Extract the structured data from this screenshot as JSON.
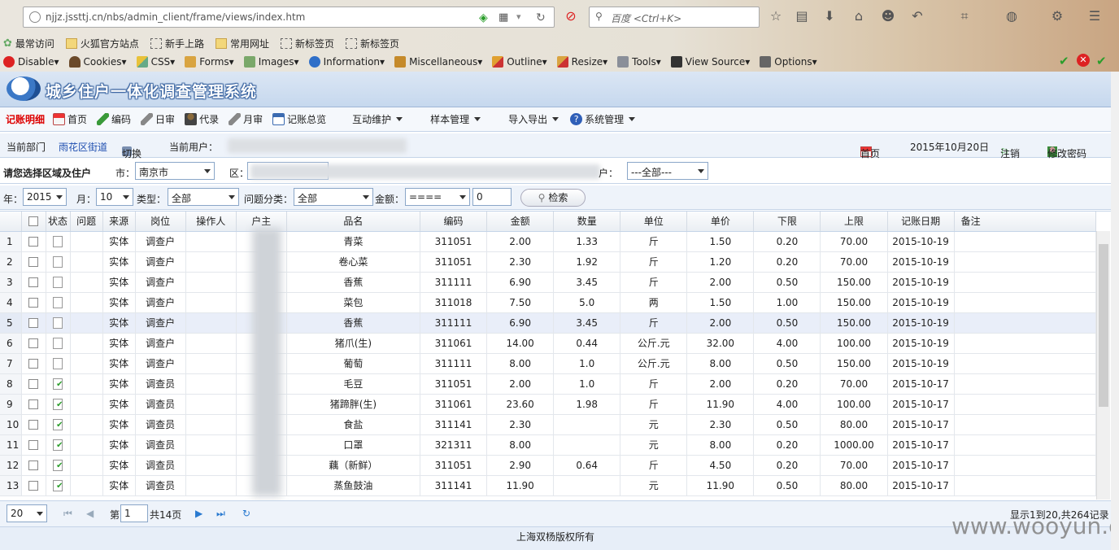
{
  "browser": {
    "url": "njjz.jssttj.cn/nbs/admin_client/frame/views/index.htm",
    "search_placeholder": "百度 <Ctrl+K>",
    "bookmarks": [
      "最常访问",
      "火狐官方站点",
      "新手上路",
      "常用网址",
      "新标签页",
      "新标签页"
    ],
    "webdev": [
      "Disable▾",
      "Cookies▾",
      "CSS▾",
      "Forms▾",
      "Images▾",
      "Information▾",
      "Miscellaneous▾",
      "Outline▾",
      "Resize▾",
      "Tools▾",
      "View Source▾",
      "Options▾"
    ]
  },
  "app": {
    "title": "城乡住户一体化调查管理系统",
    "menu": {
      "current": "记账明细",
      "items": [
        "首页",
        "编码",
        "日审",
        "代录",
        "月审",
        "记账总览"
      ],
      "dropdowns": [
        "互动维护",
        "样本管理",
        "导入导出",
        "系统管理"
      ]
    },
    "userbar": {
      "dept_label": "当前部门",
      "dept_value": "雨花区街道",
      "switch": "切换",
      "user_label": "当前用户：",
      "home": "首页",
      "date": "2015年10月20日",
      "logout": "注销",
      "change_pwd": "修改密码"
    },
    "filter1": {
      "prompt": "请您选择区域及住户",
      "city_label": "市：",
      "city_value": "南京市",
      "district_label": "区：",
      "household_label": "户：",
      "household_value": "---全部---"
    },
    "filter2": {
      "year_label": "年：",
      "year_value": "2015",
      "month_label": "月：",
      "month_value": "10",
      "type_label": "类型：",
      "type_value": "全部",
      "issue_label": "问题分类：",
      "issue_value": "全部",
      "amount_label": "金额：",
      "amount_op": "====",
      "amount_value": "0",
      "search": "检索"
    },
    "grid": {
      "columns": [
        "",
        "状态",
        "问题",
        "来源",
        "岗位",
        "操作人",
        "户主",
        "品名",
        "编码",
        "金额",
        "数量",
        "单位",
        "单价",
        "下限",
        "上限",
        "记账日期",
        "备注"
      ],
      "rows": [
        {
          "n": "1",
          "ok": false,
          "src": "实体",
          "post": "调查户",
          "name": "青菜",
          "code": "311051",
          "amt": "2.00",
          "qty": "1.33",
          "unit": "斤",
          "price": "1.50",
          "lo": "0.20",
          "hi": "70.00",
          "date": "2015-10-19"
        },
        {
          "n": "2",
          "ok": false,
          "src": "实体",
          "post": "调查户",
          "name": "卷心菜",
          "code": "311051",
          "amt": "2.30",
          "qty": "1.92",
          "unit": "斤",
          "price": "1.20",
          "lo": "0.20",
          "hi": "70.00",
          "date": "2015-10-19"
        },
        {
          "n": "3",
          "ok": false,
          "src": "实体",
          "post": "调查户",
          "name": "香蕉",
          "code": "311111",
          "amt": "6.90",
          "qty": "3.45",
          "unit": "斤",
          "price": "2.00",
          "lo": "0.50",
          "hi": "150.00",
          "date": "2015-10-19"
        },
        {
          "n": "4",
          "ok": false,
          "src": "实体",
          "post": "调查户",
          "name": "菜包",
          "code": "311018",
          "amt": "7.50",
          "qty": "5.0",
          "unit": "两",
          "price": "1.50",
          "lo": "1.00",
          "hi": "150.00",
          "date": "2015-10-19"
        },
        {
          "n": "5",
          "ok": false,
          "src": "实体",
          "post": "调查户",
          "name": "香蕉",
          "code": "311111",
          "amt": "6.90",
          "qty": "3.45",
          "unit": "斤",
          "price": "2.00",
          "lo": "0.50",
          "hi": "150.00",
          "date": "2015-10-19",
          "hl": true
        },
        {
          "n": "6",
          "ok": false,
          "src": "实体",
          "post": "调查户",
          "name": "猪爪(生)",
          "code": "311061",
          "amt": "14.00",
          "qty": "0.44",
          "unit": "公斤.元",
          "price": "32.00",
          "lo": "4.00",
          "hi": "100.00",
          "date": "2015-10-19"
        },
        {
          "n": "7",
          "ok": false,
          "src": "实体",
          "post": "调查户",
          "name": "葡萄",
          "code": "311111",
          "amt": "8.00",
          "qty": "1.0",
          "unit": "公斤.元",
          "price": "8.00",
          "lo": "0.50",
          "hi": "150.00",
          "date": "2015-10-19"
        },
        {
          "n": "8",
          "ok": true,
          "src": "实体",
          "post": "调查员",
          "name": "毛豆",
          "code": "311051",
          "amt": "2.00",
          "qty": "1.0",
          "unit": "斤",
          "price": "2.00",
          "lo": "0.20",
          "hi": "70.00",
          "date": "2015-10-17"
        },
        {
          "n": "9",
          "ok": true,
          "src": "实体",
          "post": "调查员",
          "name": "猪蹄胖(生)",
          "code": "311061",
          "amt": "23.60",
          "qty": "1.98",
          "unit": "斤",
          "price": "11.90",
          "lo": "4.00",
          "hi": "100.00",
          "date": "2015-10-17"
        },
        {
          "n": "10",
          "ok": true,
          "src": "实体",
          "post": "调查员",
          "name": "食盐",
          "code": "311141",
          "amt": "2.30",
          "qty": "",
          "unit": "元",
          "price": "2.30",
          "lo": "0.50",
          "hi": "80.00",
          "date": "2015-10-17"
        },
        {
          "n": "11",
          "ok": true,
          "src": "实体",
          "post": "调查员",
          "name": "口罩",
          "code": "321311",
          "amt": "8.00",
          "qty": "",
          "unit": "元",
          "price": "8.00",
          "lo": "0.20",
          "hi": "1000.00",
          "date": "2015-10-17"
        },
        {
          "n": "12",
          "ok": true,
          "src": "实体",
          "post": "调查员",
          "name": "藕（新鲜）",
          "code": "311051",
          "amt": "2.90",
          "qty": "0.64",
          "unit": "斤",
          "price": "4.50",
          "lo": "0.20",
          "hi": "70.00",
          "date": "2015-10-17"
        },
        {
          "n": "13",
          "ok": true,
          "src": "实体",
          "post": "调查员",
          "name": "蒸鱼鼓油",
          "code": "311141",
          "amt": "11.90",
          "qty": "",
          "unit": "元",
          "price": "11.90",
          "lo": "0.50",
          "hi": "80.00",
          "date": "2015-10-17"
        }
      ]
    },
    "pager": {
      "page_size": "20",
      "page_prefix": "第",
      "page_value": "1",
      "page_total": "共14页",
      "summary": "显示1到20,共264记录"
    },
    "footer": "上海双杨版权所有",
    "watermark": "www.wooyun.org"
  }
}
